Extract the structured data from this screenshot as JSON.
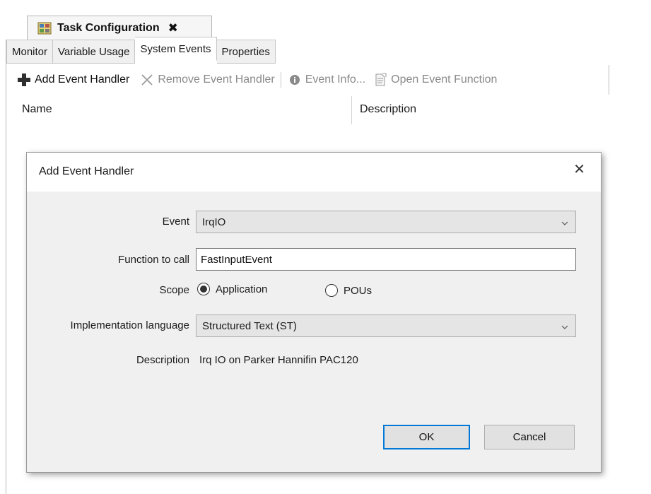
{
  "document_tab": {
    "title": "Task Configuration",
    "close_glyph": "✖",
    "icon": "task-config-icon"
  },
  "subtabs": [
    {
      "label": "Monitor",
      "active": false
    },
    {
      "label": "Variable Usage",
      "active": false
    },
    {
      "label": "System Events",
      "active": true
    },
    {
      "label": "Properties",
      "active": false
    }
  ],
  "toolbar": {
    "add_label": "Add Event Handler",
    "remove_label": "Remove Event Handler",
    "info_label": "Event Info...",
    "open_label": "Open Event Function"
  },
  "grid": {
    "columns": [
      "Name",
      "Description"
    ]
  },
  "dialog": {
    "title": "Add Event Handler",
    "close_glyph": "✕",
    "event_label": "Event",
    "event_value": "IrqIO",
    "function_label": "Function to call",
    "function_value": "FastInputEvent",
    "scope_label": "Scope",
    "scope_options": [
      {
        "label": "Application",
        "selected": true
      },
      {
        "label": "POUs",
        "selected": false
      }
    ],
    "language_label": "Implementation language",
    "language_value": "Structured Text (ST)",
    "description_label": "Description",
    "description_value": "Irq IO on Parker Hannifin PAC120",
    "ok_label": "OK",
    "cancel_label": "Cancel"
  },
  "colors": {
    "accent": "#0078d7",
    "add_icon": "#2f2f2f",
    "disabled_text": "#8a8a8a"
  }
}
